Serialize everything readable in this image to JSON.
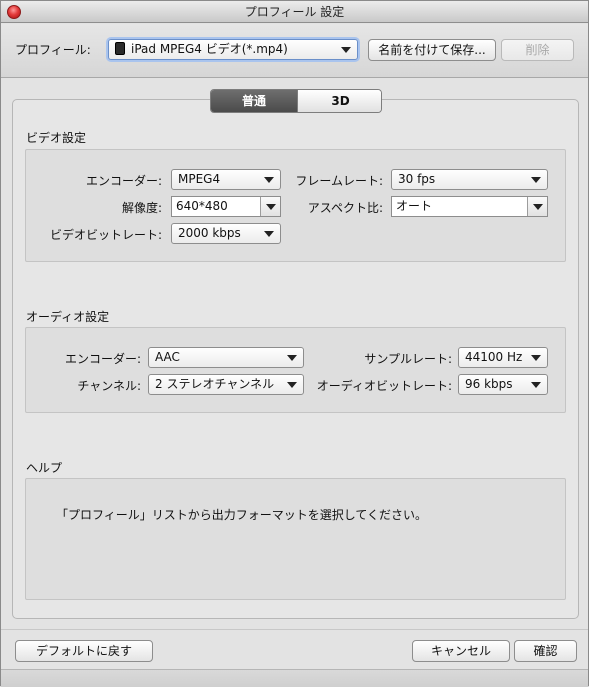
{
  "window": {
    "title": "プロフィール 設定"
  },
  "profile_bar": {
    "label": "プロフィール:",
    "selected": "iPad MPEG4 ビデオ(*.mp4)",
    "save_as_label": "名前を付けて保存...",
    "delete_label": "削除"
  },
  "tabs": [
    {
      "label": "普通",
      "active": true
    },
    {
      "label": "3D",
      "active": false
    }
  ],
  "video": {
    "section_title": "ビデオ設定",
    "encoder_label": "エンコーダー:",
    "encoder_value": "MPEG4",
    "framerate_label": "フレームレート:",
    "framerate_value": "30 fps",
    "resolution_label": "解像度:",
    "resolution_value": "640*480",
    "aspect_label": "アスペクト比:",
    "aspect_value": "オート",
    "bitrate_label": "ビデオビットレート:",
    "bitrate_value": "2000 kbps"
  },
  "audio": {
    "section_title": "オーディオ設定",
    "encoder_label": "エンコーダー:",
    "encoder_value": "AAC",
    "samplerate_label": "サンプルレート:",
    "samplerate_value": "44100 Hz",
    "channel_label": "チャンネル:",
    "channel_value": "2 ステレオチャンネル",
    "bitrate_label": "オーディオビットレート:",
    "bitrate_value": "96 kbps"
  },
  "help": {
    "section_title": "ヘルプ",
    "text": "「プロフィール」リストから出力フォーマットを選択してください。"
  },
  "footer": {
    "reset_label": "デフォルトに戻す",
    "cancel_label": "キャンセル",
    "ok_label": "確認"
  },
  "colors": {
    "close_button": "#e33b3b",
    "tab_active": "#4b4b4b",
    "focus_ring": "#a9c4ee"
  }
}
